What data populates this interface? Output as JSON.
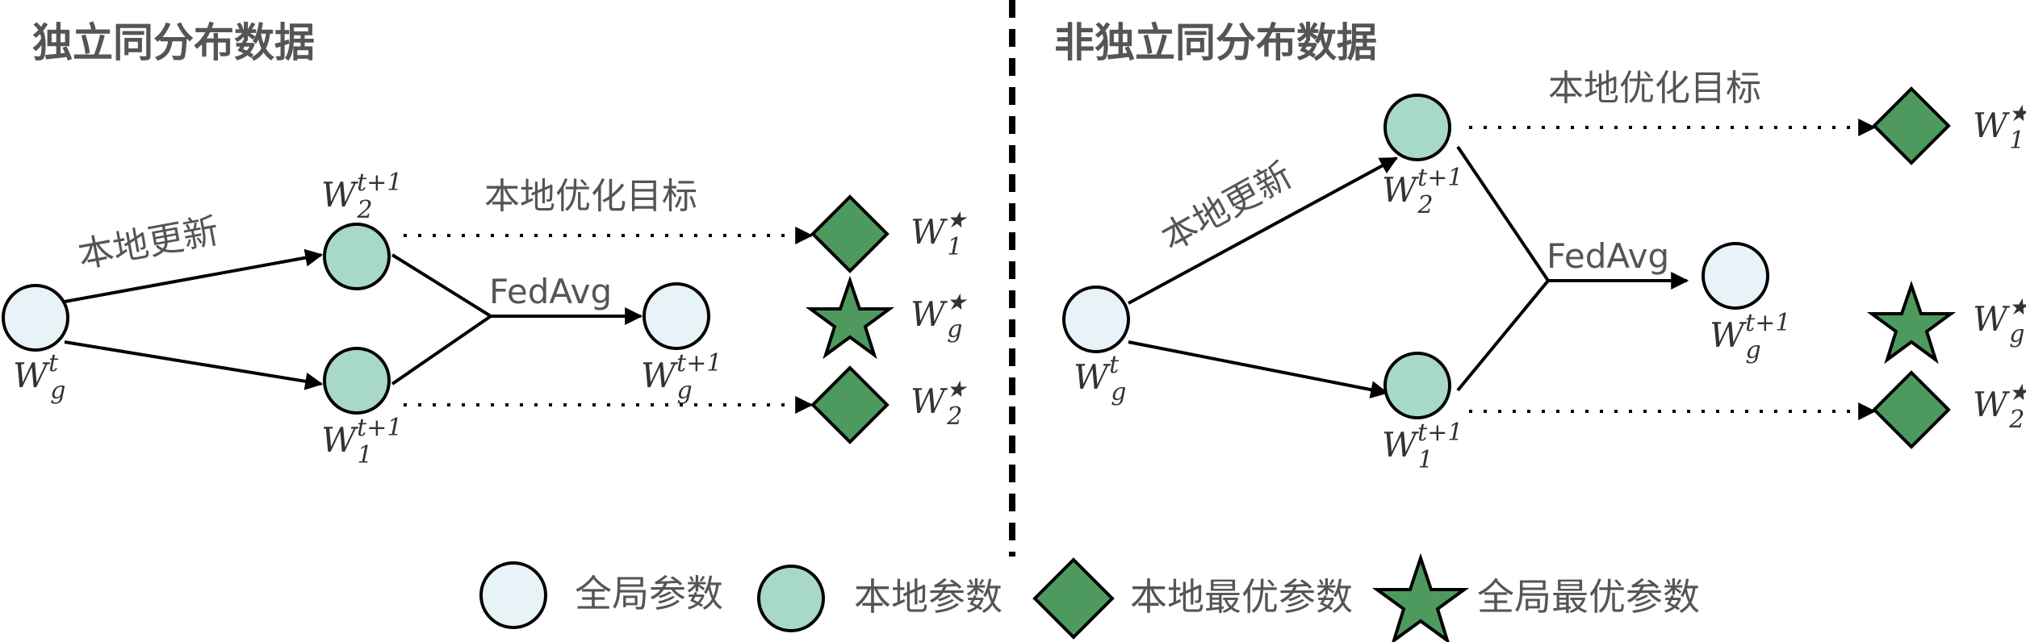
{
  "left_panel": {
    "title": "独立同分布数据",
    "local_update_label": "本地更新",
    "local_objective_label": "本地优化目标",
    "fedavg_label": "FedAvg",
    "global_t": {
      "base": "W",
      "sub": "g",
      "sup": "t"
    },
    "local2": {
      "base": "W",
      "sub": "2",
      "sup": "t+1"
    },
    "local1": {
      "base": "W",
      "sub": "1",
      "sup": "t+1"
    },
    "global_next": {
      "base": "W",
      "sub": "g",
      "sup": "t+1"
    },
    "opt1": {
      "base": "W",
      "sub": "1",
      "sup": "★"
    },
    "optg": {
      "base": "W",
      "sub": "g",
      "sup": "★"
    },
    "opt2": {
      "base": "W",
      "sub": "2",
      "sup": "★"
    }
  },
  "right_panel": {
    "title": "非独立同分布数据",
    "local_update_label": "本地更新",
    "local_objective_label": "本地优化目标",
    "fedavg_label": "FedAvg",
    "global_t": {
      "base": "W",
      "sub": "g",
      "sup": "t"
    },
    "local2": {
      "base": "W",
      "sub": "2",
      "sup": "t+1"
    },
    "local1": {
      "base": "W",
      "sub": "1",
      "sup": "t+1"
    },
    "global_next": {
      "base": "W",
      "sub": "g",
      "sup": "t+1"
    },
    "opt1": {
      "base": "W",
      "sub": "1",
      "sup": "★"
    },
    "optg": {
      "base": "W",
      "sub": "g",
      "sup": "★"
    },
    "opt2": {
      "base": "W",
      "sub": "2",
      "sup": "★"
    }
  },
  "legend": {
    "global_params": "全局参数",
    "local_params": "本地参数",
    "local_optimal": "本地最优参数",
    "global_optimal": "全局最优参数"
  },
  "colors": {
    "global_node": "#e8f3f7",
    "local_node": "#a8d8c8",
    "optimal": "#4e9a5e",
    "stroke": "#000000",
    "text": "#555555"
  }
}
